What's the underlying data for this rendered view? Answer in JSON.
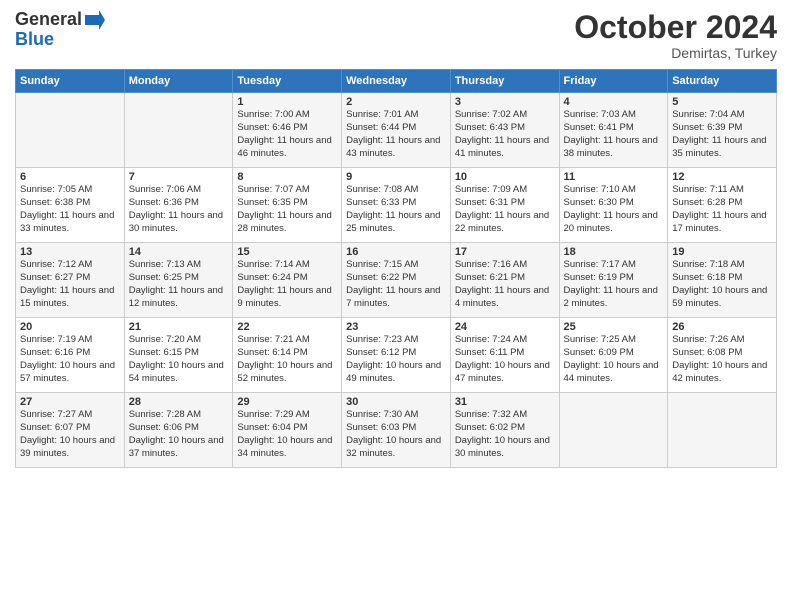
{
  "header": {
    "logo_line1": "General",
    "logo_line2": "Blue",
    "month_title": "October 2024",
    "location": "Demirtas, Turkey"
  },
  "weekdays": [
    "Sunday",
    "Monday",
    "Tuesday",
    "Wednesday",
    "Thursday",
    "Friday",
    "Saturday"
  ],
  "weeks": [
    [
      {
        "day": "",
        "info": ""
      },
      {
        "day": "",
        "info": ""
      },
      {
        "day": "1",
        "info": "Sunrise: 7:00 AM\nSunset: 6:46 PM\nDaylight: 11 hours and 46 minutes."
      },
      {
        "day": "2",
        "info": "Sunrise: 7:01 AM\nSunset: 6:44 PM\nDaylight: 11 hours and 43 minutes."
      },
      {
        "day": "3",
        "info": "Sunrise: 7:02 AM\nSunset: 6:43 PM\nDaylight: 11 hours and 41 minutes."
      },
      {
        "day": "4",
        "info": "Sunrise: 7:03 AM\nSunset: 6:41 PM\nDaylight: 11 hours and 38 minutes."
      },
      {
        "day": "5",
        "info": "Sunrise: 7:04 AM\nSunset: 6:39 PM\nDaylight: 11 hours and 35 minutes."
      }
    ],
    [
      {
        "day": "6",
        "info": "Sunrise: 7:05 AM\nSunset: 6:38 PM\nDaylight: 11 hours and 33 minutes."
      },
      {
        "day": "7",
        "info": "Sunrise: 7:06 AM\nSunset: 6:36 PM\nDaylight: 11 hours and 30 minutes."
      },
      {
        "day": "8",
        "info": "Sunrise: 7:07 AM\nSunset: 6:35 PM\nDaylight: 11 hours and 28 minutes."
      },
      {
        "day": "9",
        "info": "Sunrise: 7:08 AM\nSunset: 6:33 PM\nDaylight: 11 hours and 25 minutes."
      },
      {
        "day": "10",
        "info": "Sunrise: 7:09 AM\nSunset: 6:31 PM\nDaylight: 11 hours and 22 minutes."
      },
      {
        "day": "11",
        "info": "Sunrise: 7:10 AM\nSunset: 6:30 PM\nDaylight: 11 hours and 20 minutes."
      },
      {
        "day": "12",
        "info": "Sunrise: 7:11 AM\nSunset: 6:28 PM\nDaylight: 11 hours and 17 minutes."
      }
    ],
    [
      {
        "day": "13",
        "info": "Sunrise: 7:12 AM\nSunset: 6:27 PM\nDaylight: 11 hours and 15 minutes."
      },
      {
        "day": "14",
        "info": "Sunrise: 7:13 AM\nSunset: 6:25 PM\nDaylight: 11 hours and 12 minutes."
      },
      {
        "day": "15",
        "info": "Sunrise: 7:14 AM\nSunset: 6:24 PM\nDaylight: 11 hours and 9 minutes."
      },
      {
        "day": "16",
        "info": "Sunrise: 7:15 AM\nSunset: 6:22 PM\nDaylight: 11 hours and 7 minutes."
      },
      {
        "day": "17",
        "info": "Sunrise: 7:16 AM\nSunset: 6:21 PM\nDaylight: 11 hours and 4 minutes."
      },
      {
        "day": "18",
        "info": "Sunrise: 7:17 AM\nSunset: 6:19 PM\nDaylight: 11 hours and 2 minutes."
      },
      {
        "day": "19",
        "info": "Sunrise: 7:18 AM\nSunset: 6:18 PM\nDaylight: 10 hours and 59 minutes."
      }
    ],
    [
      {
        "day": "20",
        "info": "Sunrise: 7:19 AM\nSunset: 6:16 PM\nDaylight: 10 hours and 57 minutes."
      },
      {
        "day": "21",
        "info": "Sunrise: 7:20 AM\nSunset: 6:15 PM\nDaylight: 10 hours and 54 minutes."
      },
      {
        "day": "22",
        "info": "Sunrise: 7:21 AM\nSunset: 6:14 PM\nDaylight: 10 hours and 52 minutes."
      },
      {
        "day": "23",
        "info": "Sunrise: 7:23 AM\nSunset: 6:12 PM\nDaylight: 10 hours and 49 minutes."
      },
      {
        "day": "24",
        "info": "Sunrise: 7:24 AM\nSunset: 6:11 PM\nDaylight: 10 hours and 47 minutes."
      },
      {
        "day": "25",
        "info": "Sunrise: 7:25 AM\nSunset: 6:09 PM\nDaylight: 10 hours and 44 minutes."
      },
      {
        "day": "26",
        "info": "Sunrise: 7:26 AM\nSunset: 6:08 PM\nDaylight: 10 hours and 42 minutes."
      }
    ],
    [
      {
        "day": "27",
        "info": "Sunrise: 7:27 AM\nSunset: 6:07 PM\nDaylight: 10 hours and 39 minutes."
      },
      {
        "day": "28",
        "info": "Sunrise: 7:28 AM\nSunset: 6:06 PM\nDaylight: 10 hours and 37 minutes."
      },
      {
        "day": "29",
        "info": "Sunrise: 7:29 AM\nSunset: 6:04 PM\nDaylight: 10 hours and 34 minutes."
      },
      {
        "day": "30",
        "info": "Sunrise: 7:30 AM\nSunset: 6:03 PM\nDaylight: 10 hours and 32 minutes."
      },
      {
        "day": "31",
        "info": "Sunrise: 7:32 AM\nSunset: 6:02 PM\nDaylight: 10 hours and 30 minutes."
      },
      {
        "day": "",
        "info": ""
      },
      {
        "day": "",
        "info": ""
      }
    ]
  ]
}
